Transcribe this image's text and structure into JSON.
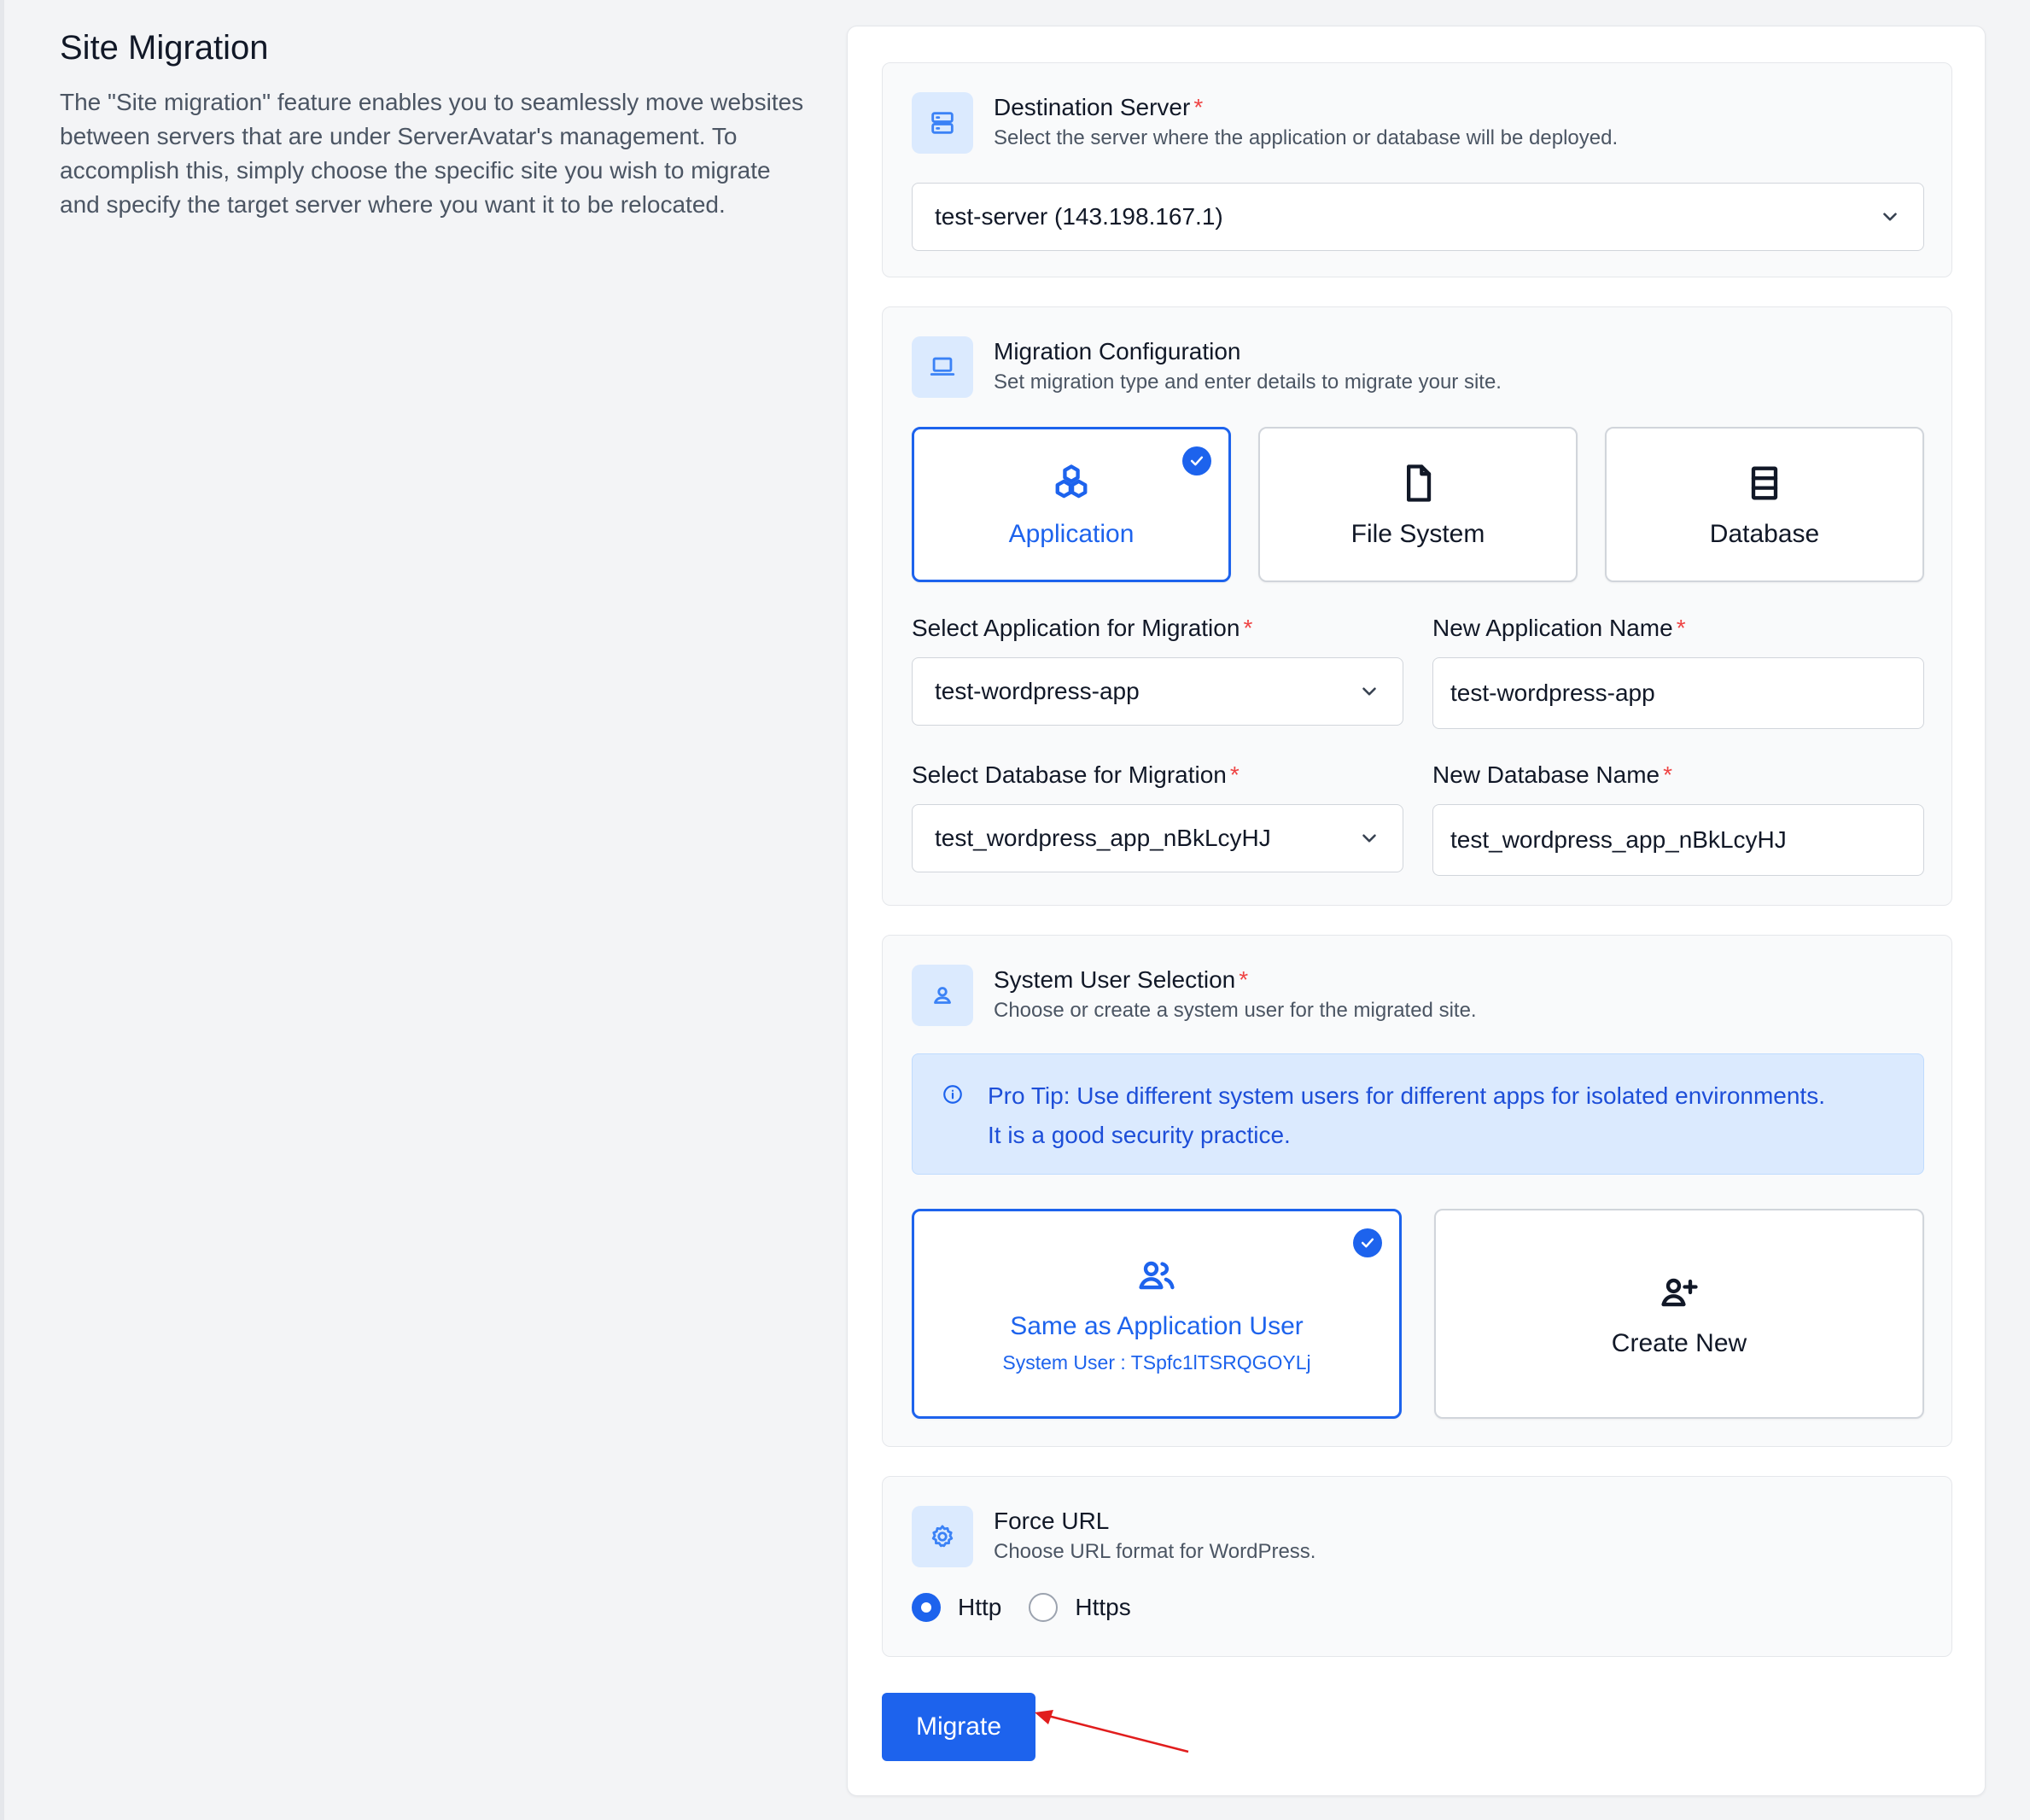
{
  "intro": {
    "title": "Site Migration",
    "description": "The \"Site migration\" feature enables you to seamlessly move websites between servers that are under ServerAvatar's management. To accomplish this, simply choose the specific site you wish to migrate and specify the target server where you want it to be relocated."
  },
  "destination": {
    "title": "Destination Server",
    "required_mark": "*",
    "description": "Select the server where the application or database will be deployed.",
    "selected": "test-server (143.198.167.1)",
    "icon": "server-icon"
  },
  "migration": {
    "title": "Migration Configuration",
    "description": "Set migration type and enter details to migrate your site.",
    "icon": "laptop-icon",
    "types": [
      {
        "label": "Application",
        "icon": "cubes-icon",
        "selected": true
      },
      {
        "label": "File System",
        "icon": "file-icon",
        "selected": false
      },
      {
        "label": "Database",
        "icon": "database-icon",
        "selected": false
      }
    ],
    "app_select_label": "Select Application for Migration",
    "app_select_value": "test-wordpress-app",
    "app_name_label": "New Application Name",
    "app_name_value": "test-wordpress-app",
    "db_select_label": "Select Database for Migration",
    "db_select_value": "test_wordpress_app_nBkLcyHJ",
    "db_name_label": "New Database Name",
    "db_name_value": "test_wordpress_app_nBkLcyHJ"
  },
  "system_user": {
    "title": "System User Selection",
    "description": "Choose or create a system user for the migrated site.",
    "icon": "user-icon",
    "tip_line1": "Pro Tip: Use different system users for different apps for isolated environments.",
    "tip_line2": "It is a good security practice.",
    "same_label": "Same as Application User",
    "same_sub": "System User :  TSpfc1lTSRQGOYLj",
    "create_label": "Create New"
  },
  "force_url": {
    "title": "Force URL",
    "description": "Choose URL format for WordPress.",
    "icon": "gear-icon",
    "options": [
      "Http",
      "Https"
    ],
    "selected": "Http"
  },
  "actions": {
    "migrate_label": "Migrate"
  },
  "colors": {
    "accent": "#1d63ed",
    "required": "#ef4444",
    "tip_bg": "#dbeafe",
    "annotation_arrow": "#e11d1d"
  }
}
